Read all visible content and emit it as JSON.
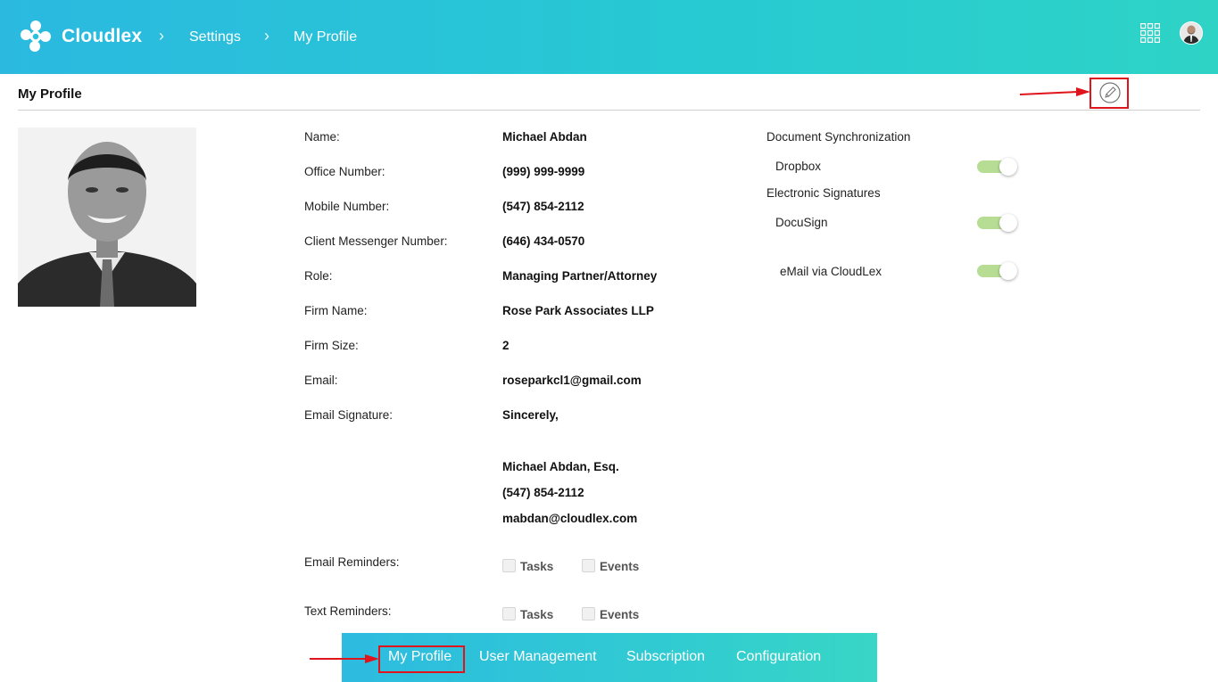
{
  "header": {
    "brand": "Cloudlex",
    "breadcrumbs": [
      "Settings",
      "My Profile"
    ]
  },
  "page": {
    "title": "My Profile"
  },
  "profile": {
    "fields": [
      {
        "label": "Name:",
        "value": "Michael Abdan"
      },
      {
        "label": "Office Number:",
        "value": "(999) 999-9999"
      },
      {
        "label": "Mobile Number:",
        "value": "(547) 854-2112"
      },
      {
        "label": "Client Messenger Number:",
        "value": "(646) 434-0570"
      },
      {
        "label": "Role:",
        "value": "Managing Partner/Attorney"
      },
      {
        "label": "Firm Name:",
        "value": "Rose Park Associates LLP"
      },
      {
        "label": "Firm Size:",
        "value": "2"
      },
      {
        "label": "Email:",
        "value": "roseparkcl1@gmail.com"
      }
    ],
    "signature": {
      "label": "Email Signature:",
      "lines": [
        "Sincerely,",
        "Michael Abdan, Esq.",
        "(547) 854-2112",
        "mabdan@cloudlex.com"
      ]
    },
    "email_reminders": {
      "label": "Email Reminders:",
      "options": [
        {
          "label": "Tasks",
          "checked": false
        },
        {
          "label": "Events",
          "checked": false
        }
      ]
    },
    "text_reminders": {
      "label": "Text Reminders:",
      "options": [
        {
          "label": "Tasks",
          "checked": false
        },
        {
          "label": "Events",
          "checked": false
        }
      ]
    }
  },
  "integrations": {
    "document_sync": {
      "title": "Document Synchronization",
      "items": [
        {
          "label": "Dropbox",
          "enabled": true
        }
      ]
    },
    "esign": {
      "title": "Electronic Signatures",
      "items": [
        {
          "label": "DocuSign",
          "enabled": true
        }
      ]
    },
    "email": {
      "label": "eMail via CloudLex",
      "enabled": true
    }
  },
  "tabs": {
    "items": [
      "My Profile",
      "User Management",
      "Subscription",
      "Configuration"
    ],
    "active": "My Profile"
  },
  "colors": {
    "header_gradient_start": "#2bb9e0",
    "header_gradient_end": "#2ed3c6",
    "toggle_on": "#b7dd95",
    "annotation_red": "#e0141b"
  }
}
